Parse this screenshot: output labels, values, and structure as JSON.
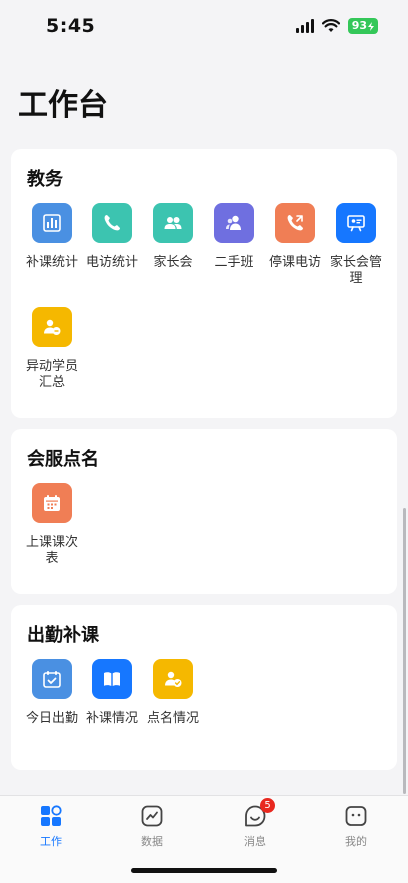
{
  "status_bar": {
    "time": "5:45",
    "battery": "93"
  },
  "page_title": "工作台",
  "sections": [
    {
      "title": "教务",
      "items": [
        {
          "label": "补课统计",
          "icon": "bar-chart-icon",
          "color": "#4a90e2"
        },
        {
          "label": "电访统计",
          "icon": "phone-icon",
          "color": "#3cc4b0"
        },
        {
          "label": "家长会",
          "icon": "people-icon",
          "color": "#3cc4b0"
        },
        {
          "label": "二手班",
          "icon": "group-icon",
          "color": "#6f6fe0"
        },
        {
          "label": "停课电访",
          "icon": "phone-call-icon",
          "color": "#f07e55"
        },
        {
          "label": "家长会管理",
          "icon": "presentation-icon",
          "color": "#1677ff"
        },
        {
          "label": "异动学员汇总",
          "icon": "user-chat-icon",
          "color": "#f5b800"
        }
      ]
    },
    {
      "title": "会服点名",
      "items": [
        {
          "label": "上课课次表",
          "icon": "calendar-icon",
          "color": "#f07e55"
        }
      ]
    },
    {
      "title": "出勤补课",
      "items": [
        {
          "label": "今日出勤",
          "icon": "calendar-check-icon",
          "color": "#4a90e2"
        },
        {
          "label": "补课情况",
          "icon": "book-icon",
          "color": "#1677ff"
        },
        {
          "label": "点名情况",
          "icon": "user-check-icon",
          "color": "#f5b800"
        }
      ]
    }
  ],
  "tabbar": {
    "tabs": [
      {
        "label": "工作",
        "icon": "grid-icon",
        "active": true
      },
      {
        "label": "数据",
        "icon": "chart-icon",
        "active": false
      },
      {
        "label": "消息",
        "icon": "message-icon",
        "active": false,
        "badge": "5"
      },
      {
        "label": "我的",
        "icon": "profile-icon",
        "active": false
      }
    ]
  }
}
